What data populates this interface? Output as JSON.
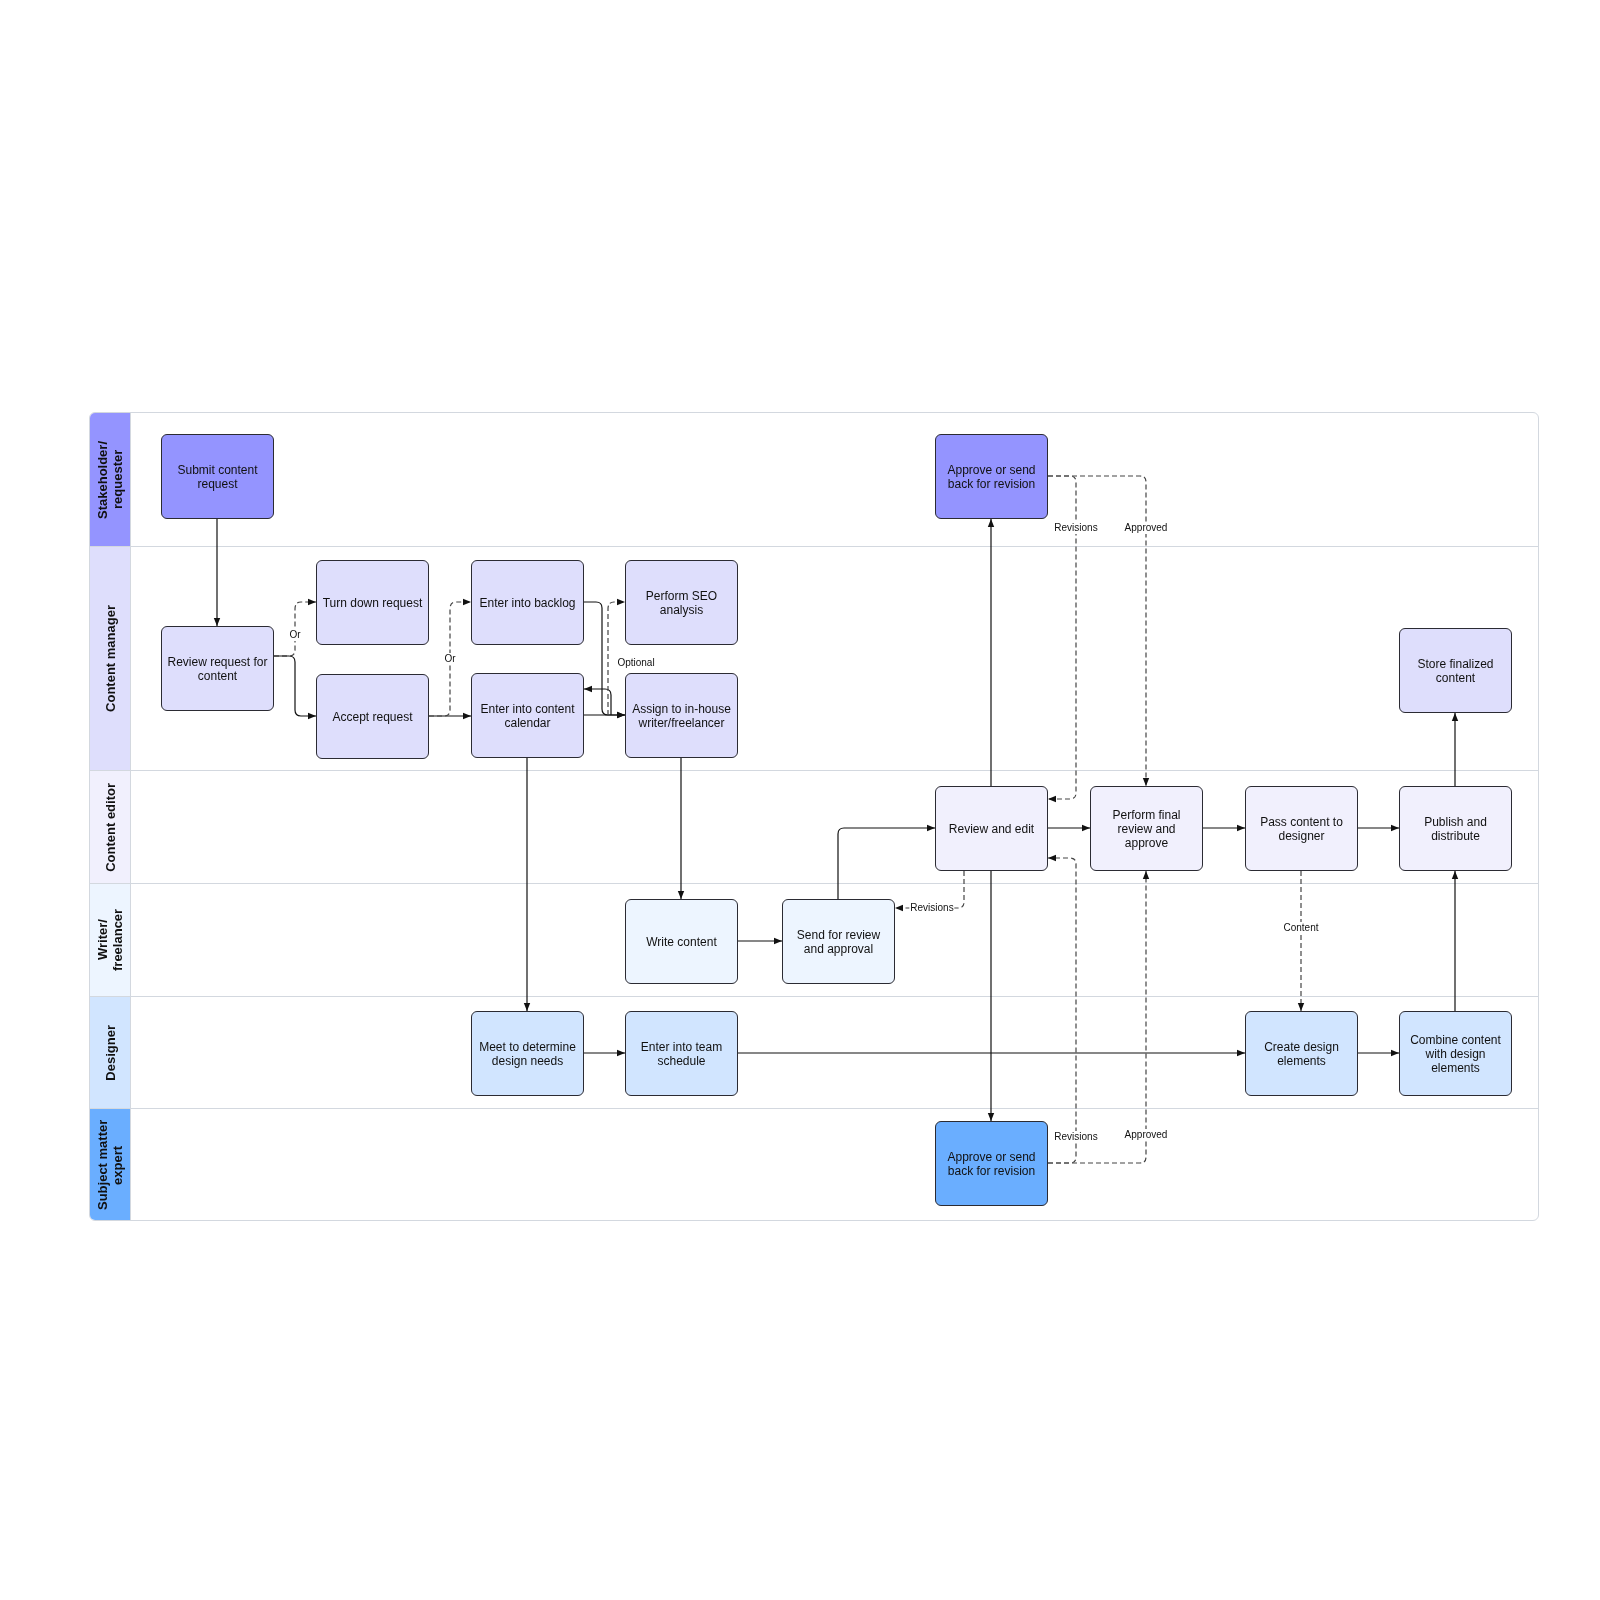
{
  "lanes": [
    {
      "label": "Stakeholder/ requester",
      "color": "#9494ff",
      "nodes": [
        {
          "text": "Submit content request"
        },
        {
          "text": "Approve or send back for revision"
        }
      ]
    },
    {
      "label": "Content manager",
      "color": "#dedefc",
      "nodes": [
        {
          "text": "Review request for content"
        },
        {
          "text": "Turn down request"
        },
        {
          "text": "Accept request"
        },
        {
          "text": "Enter into backlog"
        },
        {
          "text": "Enter into content calendar"
        },
        {
          "text": "Perform SEO analysis"
        },
        {
          "text": "Assign to in-house writer/freelancer"
        },
        {
          "text": "Store finalized content"
        }
      ]
    },
    {
      "label": "Content editor",
      "color": "#f1f0fd",
      "nodes": [
        {
          "text": "Review and edit"
        },
        {
          "text": "Perform final review and approve"
        },
        {
          "text": "Pass content to designer"
        },
        {
          "text": "Publish and distribute"
        }
      ]
    },
    {
      "label": "Writer/ freelancer",
      "color": "#edf5ff",
      "nodes": [
        {
          "text": "Write content"
        },
        {
          "text": "Send for review and approval"
        }
      ]
    },
    {
      "label": "Designer",
      "color": "#d1e5ff",
      "nodes": [
        {
          "text": "Meet to determine design needs"
        },
        {
          "text": "Enter into team schedule"
        },
        {
          "text": "Create design elements"
        },
        {
          "text": "Combine content with design elements"
        }
      ]
    },
    {
      "label": "Subject matter expert",
      "color": "#6aaeff",
      "nodes": [
        {
          "text": "Approve or send back for revision"
        }
      ]
    }
  ],
  "connector_labels": [
    "Or",
    "Or",
    "Optional",
    "Revisions",
    "Approved",
    "Revisions",
    "Content",
    "Revisions",
    "Approved"
  ]
}
